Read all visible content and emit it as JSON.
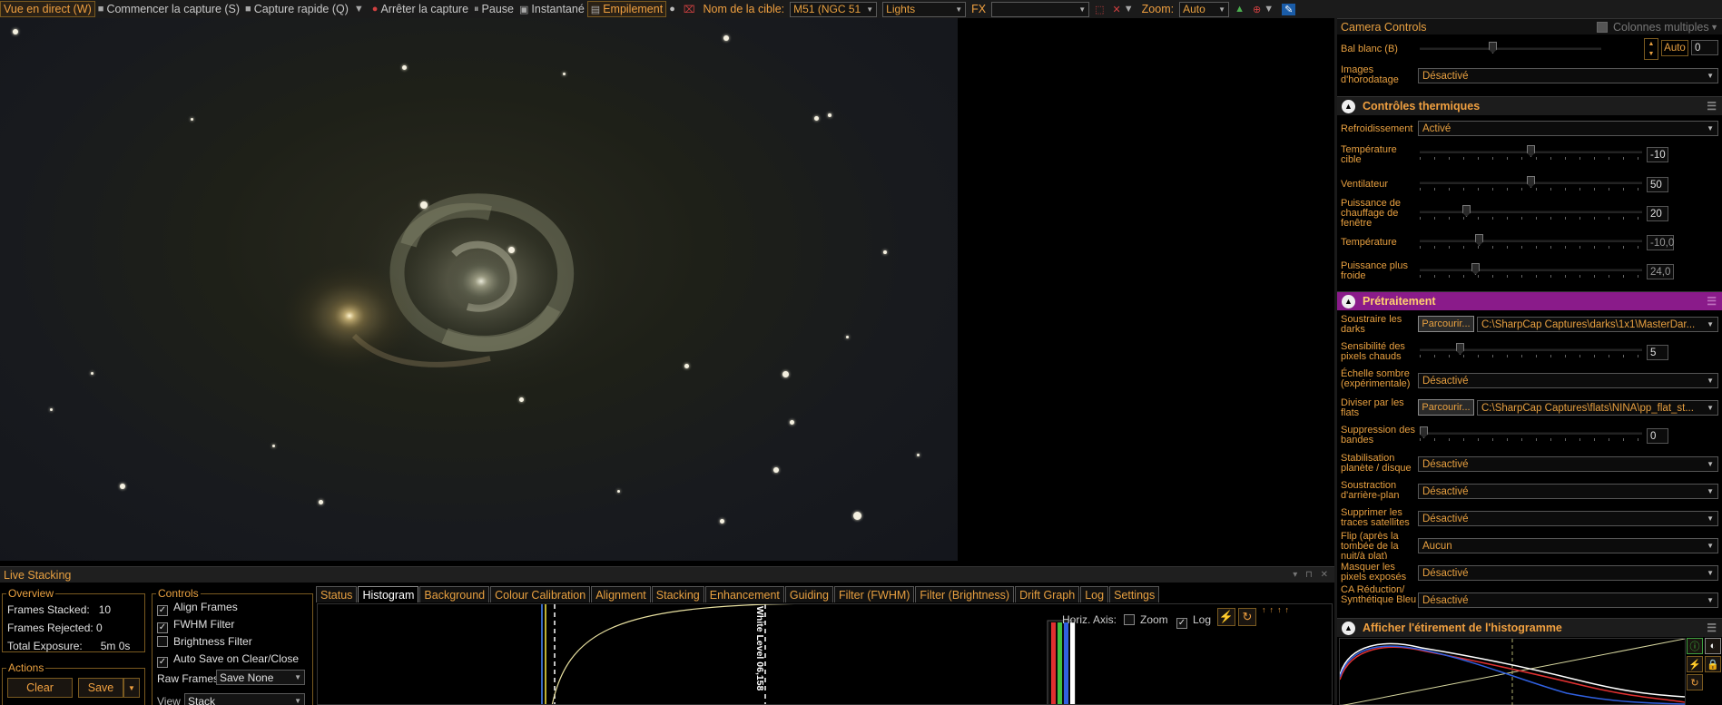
{
  "toolbar": {
    "live_view": "Vue en direct (W)",
    "start_capture": "Commencer la capture (S)",
    "quick_capture": "Capture rapide (Q)",
    "stop_capture": "Arrêter la capture",
    "pause": "Pause",
    "snapshot": "Instantané",
    "stacking": "Empilement",
    "target_label": "Nom de la cible:",
    "target_value": "M51 (NGC 51",
    "frame_type": "Lights",
    "fx_label": "FX",
    "fx_value": "",
    "zoom_label": "Zoom:",
    "zoom_value": "Auto"
  },
  "live_stacking": {
    "title": "Live Stacking",
    "overview": {
      "title": "Overview",
      "frames_stacked_label": "Frames Stacked:",
      "frames_stacked": "10",
      "frames_rejected_label": "Frames Rejected:",
      "frames_rejected": "0",
      "total_exposure_label": "Total Exposure:",
      "total_exposure": "5m 0s"
    },
    "actions": {
      "title": "Actions",
      "clear": "Clear",
      "save": "Save"
    },
    "controls": {
      "title": "Controls",
      "align_frames": "Align Frames",
      "fwhm_filter": "FWHM Filter",
      "brightness_filter": "Brightness Filter",
      "auto_save": "Auto Save on Clear/Close",
      "raw_frames_label": "Raw Frames",
      "raw_frames_value": "Save None",
      "view_label": "View",
      "view_value": "Stack"
    },
    "tabs": [
      "Status",
      "Histogram",
      "Background",
      "Colour Calibration",
      "Alignment",
      "Stacking",
      "Enhancement",
      "Guiding",
      "Filter (FWHM)",
      "Filter (Brightness)",
      "Drift Graph",
      "Log",
      "Settings"
    ],
    "active_tab": "Histogram",
    "histogram": {
      "horiz_axis_label": "Horiz. Axis:",
      "zoom_label": "Zoom",
      "log_label": "Log",
      "white_level_label": "White Level",
      "white_level_value": "06,158"
    }
  },
  "right_panel": {
    "camera_controls": {
      "title": "Camera Controls",
      "multi_columns": "Colonnes multiples",
      "wb_blue_label": "Bal blanc (B)",
      "wb_blue_auto": "Auto",
      "wb_blue_value": "0",
      "wb_blue_level": 0.4,
      "timestamp_label": "Images d'horodatage",
      "timestamp_value": "Désactivé"
    },
    "thermal": {
      "title": "Contrôles thermiques",
      "cooling_label": "Refroidissement",
      "cooling_value": "Activé",
      "target_temp_label": "Température cible",
      "target_temp_value": "-10",
      "target_temp_level": 0.5,
      "fan_label": "Ventilateur",
      "fan_value": "50",
      "fan_level": 0.5,
      "heater_label": "Puissance de chauffage de fenêtre",
      "heater_value": "20",
      "heater_level": 0.2,
      "temp_label": "Température",
      "temp_value": "-10,0",
      "temp_level": 0.26,
      "cooler_power_label": "Puissance plus froide",
      "cooler_power_value": "24,0",
      "cooler_power_level": 0.24
    },
    "preprocessing": {
      "title": "Prétraitement",
      "subtract_darks_label": "Soustraire les darks",
      "browse_label": "Parcourir...",
      "darks_path": "C:\\SharpCap Captures\\darks\\1x1\\MasterDar...",
      "hot_pixel_label": "Sensibilité des pixels chauds",
      "hot_pixel_value": "5",
      "hot_pixel_level": 0.17,
      "dark_scale_label": "Échelle sombre (expérimentale)",
      "dark_scale_value": "Désactivé",
      "divide_flats_label": "Diviser par les flats",
      "flats_path": "C:\\SharpCap Captures\\flats\\NINA\\pp_flat_st...",
      "banding_label": "Suppression des bandes",
      "banding_value": "0",
      "banding_level": 0.0,
      "stabilization_label": "Stabilisation planète / disque",
      "stabilization_value": "Désactivé",
      "background_sub_label": "Soustraction d'arrière-plan",
      "background_sub_value": "Désactivé",
      "satellite_label": "Supprimer les traces satellites",
      "satellite_value": "Désactivé",
      "flip_label": "Flip (après la tombée de la nuit/à plat)",
      "flip_value": "Aucun",
      "mask_label": "Masquer les pixels exposés",
      "mask_value": "Désactivé",
      "ca_label": "CA Réduction/ Synthétique Bleu",
      "ca_value": "Désactivé"
    },
    "histogram_stretch": {
      "title": "Afficher l'étirement de l'histogramme"
    }
  },
  "colors": {
    "accent": "#f0a040",
    "purple_header": "#8a1b8a",
    "background": "#000000"
  }
}
